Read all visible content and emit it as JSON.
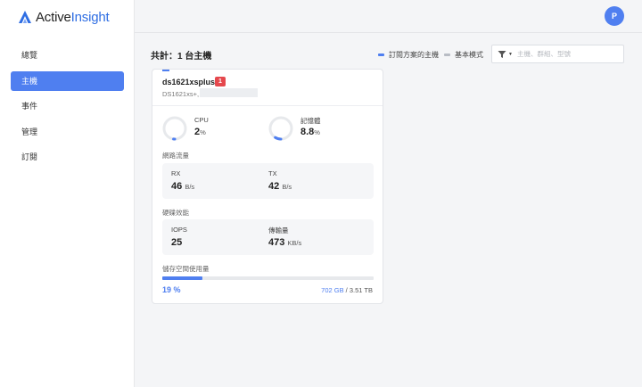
{
  "brand": {
    "part1": "Active",
    "part2": "Insight",
    "accent_color": "#2f6ee3"
  },
  "sidebar": {
    "items": [
      {
        "label": "總覽",
        "active": false
      },
      {
        "label": "主機",
        "active": true
      },
      {
        "label": "事件",
        "active": false
      },
      {
        "label": "管理",
        "active": false
      },
      {
        "label": "訂閱",
        "active": false
      }
    ]
  },
  "user": {
    "avatar_initial": "P"
  },
  "header": {
    "total_label": "共計：1 台主機",
    "legend_subscribed": "訂閱方案的主機",
    "legend_basic": "基本模式",
    "search_placeholder": "主機、群組、型號"
  },
  "host": {
    "name": "ds1621xsplus",
    "alert_count": "1",
    "model": "DS1621xs+,",
    "cpu": {
      "label": "CPU",
      "value": "2",
      "unit": "%",
      "fraction": 0.02
    },
    "memory": {
      "label": "記憶體",
      "value": "8.8",
      "unit": "%",
      "fraction": 0.088
    },
    "network": {
      "title": "網路流量",
      "rx_label": "RX",
      "rx_value": "46",
      "rx_unit": "B/s",
      "tx_label": "TX",
      "tx_value": "42",
      "tx_unit": "B/s"
    },
    "disk": {
      "title": "硬碟效能",
      "iops_label": "IOPS",
      "iops_value": "25",
      "throughput_label": "傳輸量",
      "throughput_value": "473",
      "throughput_unit": "KB/s"
    },
    "storage": {
      "title": "儲存空間使用量",
      "percent_label": "19 %",
      "fraction": 0.19,
      "used": "702 GB",
      "separator": " / ",
      "total": "3.51 TB"
    }
  },
  "colors": {
    "primary": "#4f7ff0",
    "alert": "#e5484d"
  }
}
